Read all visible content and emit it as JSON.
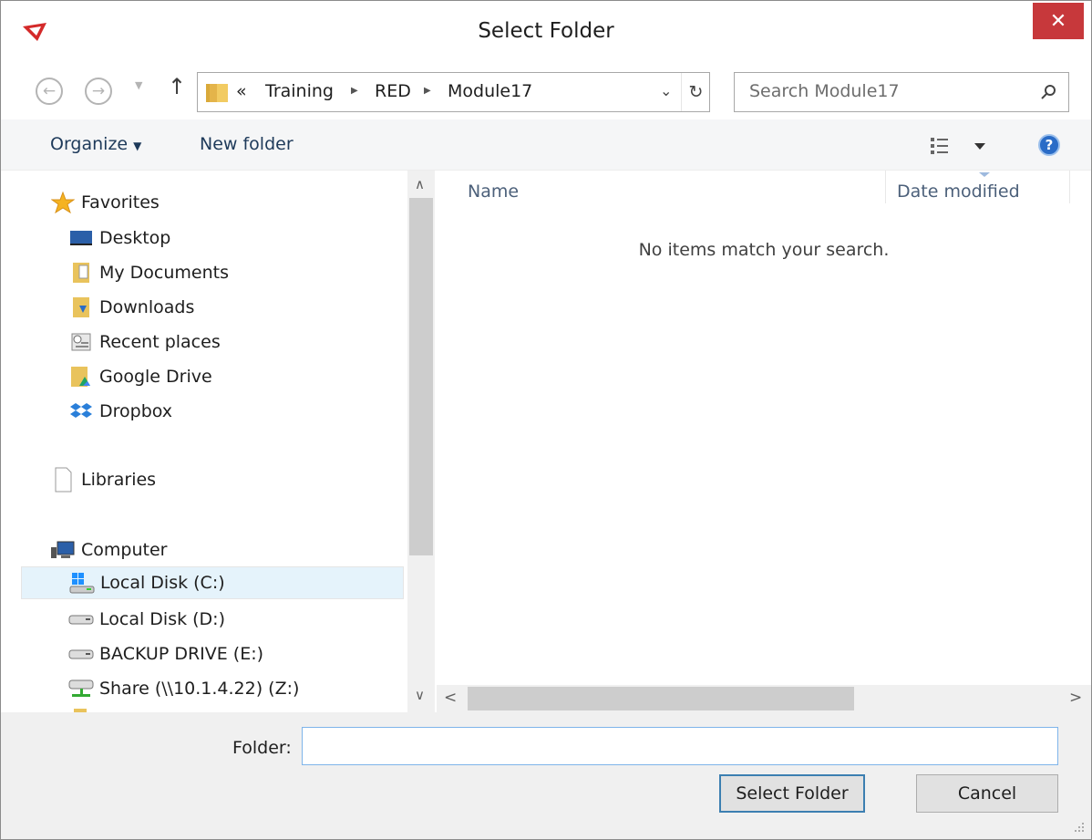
{
  "window": {
    "title": "Select Folder",
    "close_label": "✕"
  },
  "nav": {
    "back_label": "←",
    "forward_label": "→",
    "up_label": "↑",
    "breadcrumb_prefix": "«",
    "breadcrumb": [
      "Training",
      "RED",
      "Module17"
    ],
    "refresh_label": "↻",
    "dropdown_label": "⌄"
  },
  "search": {
    "placeholder": "Search Module17"
  },
  "toolbar": {
    "organize_label": "Organize",
    "new_folder_label": "New folder",
    "help_label": "?"
  },
  "sidebar": {
    "favorites": {
      "label": "Favorites",
      "items": [
        "Desktop",
        "My Documents",
        "Downloads",
        "Recent places",
        "Google Drive",
        "Dropbox"
      ]
    },
    "libraries_label": "Libraries",
    "computer": {
      "label": "Computer",
      "items": [
        "Local Disk (C:)",
        "Local Disk (D:)",
        "BACKUP DRIVE (E:)",
        "Share (\\\\10.1.4.22) (Z:)"
      ],
      "selected": "Local Disk (C:)"
    }
  },
  "file_list": {
    "columns": [
      "Name",
      "Date modified"
    ],
    "empty_message": "No items match your search."
  },
  "footer": {
    "folder_label": "Folder:",
    "folder_value": "",
    "select_button": "Select Folder",
    "cancel_button": "Cancel"
  },
  "colors": {
    "close_button": "#c7383b",
    "selection": "#e5f3fb",
    "accent_border": "#3c7fb1",
    "header_text": "#4c607a"
  }
}
